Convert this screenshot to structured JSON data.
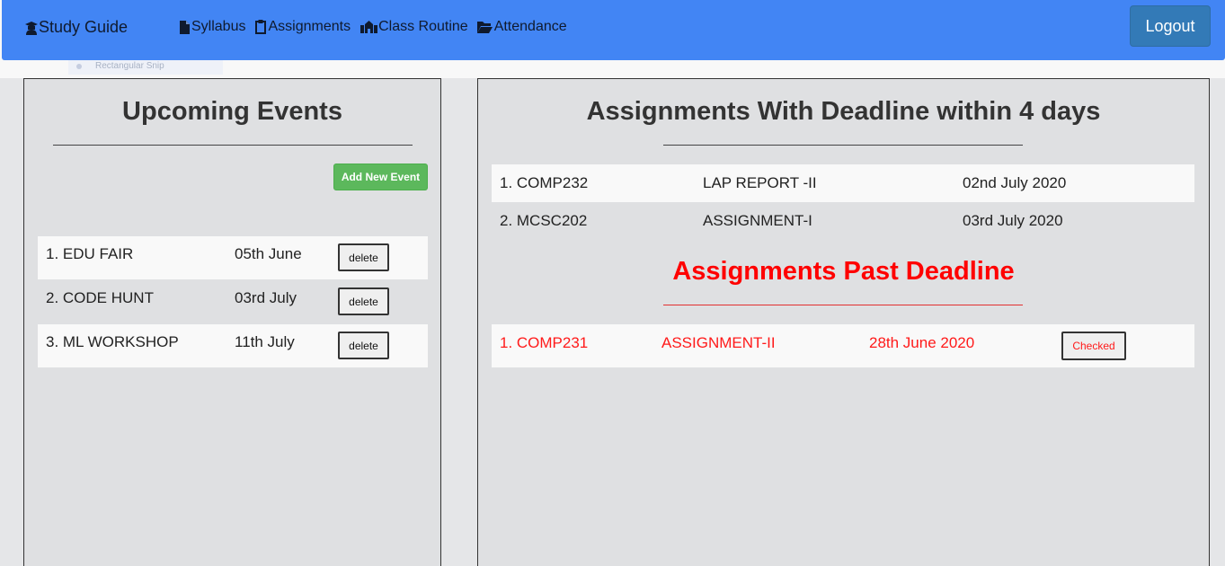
{
  "nav": {
    "brand": "Study Guide",
    "links": [
      {
        "label": "Syllabus",
        "icon": "file-icon"
      },
      {
        "label": "Assignments",
        "icon": "clipboard-icon"
      },
      {
        "label": "Class Routine",
        "icon": "school-icon"
      },
      {
        "label": "Attendance",
        "icon": "folder-open-icon"
      }
    ],
    "logout_label": "Logout"
  },
  "ghost_label": "Rectangular Snip",
  "events": {
    "title": "Upcoming Events",
    "add_label": "Add New Event",
    "rows": [
      {
        "name": "1. EDU FAIR",
        "date": "05th June",
        "action": "delete"
      },
      {
        "name": "2. CODE HUNT",
        "date": "03rd July",
        "action": "delete"
      },
      {
        "name": "3. ML WORKSHOP",
        "date": "11th July",
        "action": "delete"
      }
    ]
  },
  "assignments": {
    "title": "Assignments With Deadline within 4 days",
    "rows": [
      {
        "course": "1. COMP232",
        "name": "LAP REPORT -II",
        "date": "02nd July 2020"
      },
      {
        "course": "2. MCSC202",
        "name": "ASSIGNMENT-I",
        "date": "03rd July 2020"
      }
    ],
    "past_title": "Assignments Past Deadline",
    "past_rows": [
      {
        "course": "1. COMP231",
        "name": "ASSIGNMENT-II",
        "date": "28th June 2020",
        "action": "Checked"
      }
    ]
  },
  "colors": {
    "navbar": "#4285f4",
    "logout": "#337ab7",
    "add_button": "#5cb85c",
    "past_deadline": "#ff0000"
  }
}
